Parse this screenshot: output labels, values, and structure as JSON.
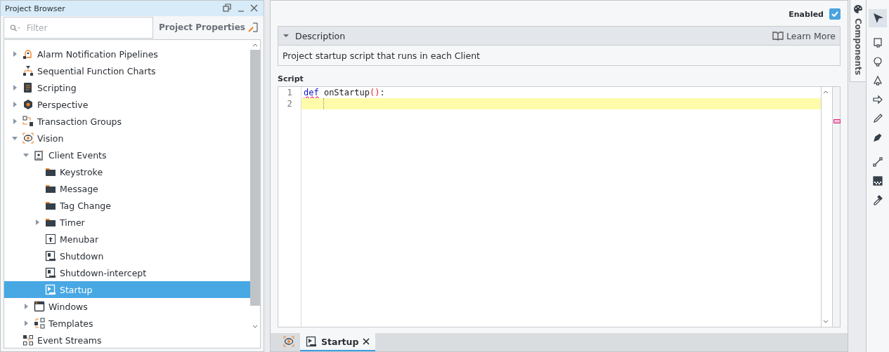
{
  "project_browser": {
    "title": "Project Browser",
    "filter": {
      "placeholder": "Filter"
    },
    "properties_button": "Project Properties",
    "tree": [
      {
        "label": "Alarm Notification Pipelines",
        "kind": "alarm",
        "expandable": true,
        "expanded": false,
        "selected": false
      },
      {
        "label": "Sequential Function Charts",
        "kind": "sfc",
        "expandable": false,
        "selected": false
      },
      {
        "label": "Scripting",
        "kind": "script",
        "expandable": true,
        "expanded": false,
        "selected": false
      },
      {
        "label": "Perspective",
        "kind": "perspective",
        "expandable": true,
        "expanded": false,
        "selected": false
      },
      {
        "label": "Transaction Groups",
        "kind": "transaction",
        "expandable": true,
        "expanded": false,
        "selected": false
      },
      {
        "label": "Vision",
        "kind": "vision",
        "expandable": true,
        "expanded": true,
        "selected": false,
        "children": [
          {
            "label": "Client Events",
            "kind": "events",
            "expandable": true,
            "expanded": true,
            "selected": false,
            "children": [
              {
                "label": "Keystroke",
                "kind": "folder",
                "expandable": false,
                "selected": false
              },
              {
                "label": "Message",
                "kind": "folder",
                "expandable": false,
                "selected": false
              },
              {
                "label": "Tag Change",
                "kind": "folder",
                "expandable": false,
                "selected": false
              },
              {
                "label": "Timer",
                "kind": "folder",
                "expandable": true,
                "expanded": false,
                "selected": false
              },
              {
                "label": "Menubar",
                "kind": "menubar",
                "expandable": false,
                "selected": false
              },
              {
                "label": "Shutdown",
                "kind": "page",
                "expandable": false,
                "selected": false
              },
              {
                "label": "Shutdown-intercept",
                "kind": "page",
                "expandable": false,
                "selected": false
              },
              {
                "label": "Startup",
                "kind": "startup",
                "expandable": false,
                "selected": true
              }
            ]
          },
          {
            "label": "Windows",
            "kind": "windows",
            "expandable": true,
            "expanded": false,
            "selected": false
          },
          {
            "label": "Templates",
            "kind": "templates",
            "expandable": true,
            "expanded": false,
            "selected": false
          }
        ]
      },
      {
        "label": "Event Streams",
        "kind": "streams",
        "expandable": false,
        "selected": false
      }
    ]
  },
  "editor": {
    "enabled": {
      "label": "Enabled",
      "checked": true
    },
    "description": {
      "title": "Description",
      "expanded": true,
      "learn_more": "Learn More",
      "text": "Project startup script that runs in each Client"
    },
    "script_label": "Script",
    "lines": [
      {
        "number": "1",
        "current": false,
        "tokens": [
          {
            "text": "def",
            "kind": "keyword"
          },
          {
            "text": " onStartup",
            "kind": "name"
          },
          {
            "text": "()",
            "kind": "paren"
          },
          {
            "text": ":",
            "kind": "name"
          }
        ]
      },
      {
        "number": "2",
        "current": true
      }
    ]
  },
  "bottom_tabs": [
    {
      "kind": "vision",
      "selected": false
    },
    {
      "kind": "startup",
      "label": "Startup",
      "selected": true,
      "closable": true
    }
  ],
  "side_tab": "Components",
  "tools": [
    {
      "kind": "pointer",
      "selected": true
    },
    {
      "kind": "rect",
      "selected": false
    },
    {
      "kind": "ellipse",
      "selected": false
    },
    {
      "kind": "polygon",
      "selected": false
    },
    {
      "kind": "arrow",
      "selected": false
    },
    {
      "kind": "pencil",
      "selected": false
    },
    {
      "kind": "pen",
      "selected": false
    },
    {
      "kind": "line",
      "selected": false
    },
    {
      "kind": "gradient",
      "selected": false
    },
    {
      "kind": "eyedropper",
      "selected": false
    }
  ]
}
